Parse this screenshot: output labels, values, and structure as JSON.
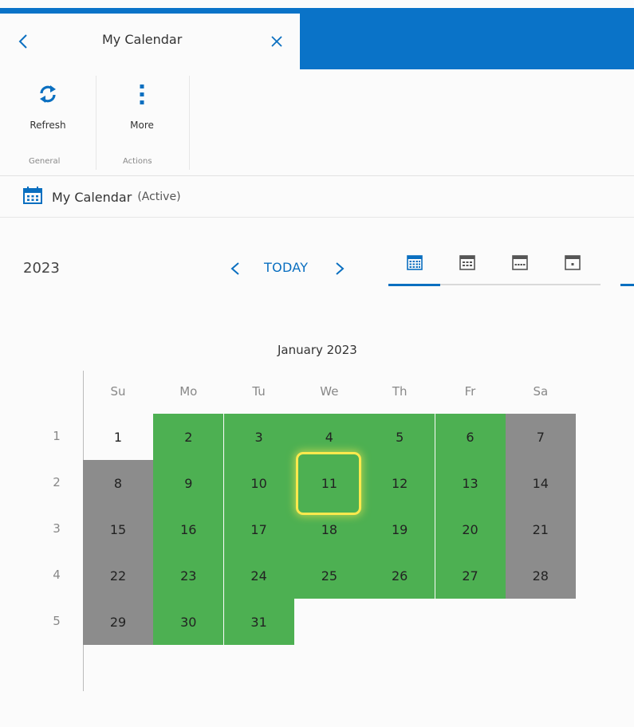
{
  "tab": {
    "title": "My Calendar",
    "back_icon": "chevron-left-icon",
    "close_icon": "close-icon"
  },
  "ribbon": {
    "refresh_label": "Refresh",
    "more_label": "More",
    "group_general": "General",
    "group_actions": "Actions"
  },
  "breadcrumb": {
    "icon": "calendar-icon",
    "name": "My Calendar",
    "state": "(Active)"
  },
  "nav": {
    "year": "2023",
    "today_label": "TODAY",
    "views": [
      "year-view-icon",
      "month-view-icon",
      "week-view-icon",
      "day-view-icon"
    ],
    "active_view": 0
  },
  "calendar": {
    "month_title": "January 2023",
    "weekdays": [
      "Su",
      "Mo",
      "Tu",
      "We",
      "Th",
      "Fr",
      "Sa"
    ],
    "week_numbers": [
      "1",
      "2",
      "3",
      "4",
      "5"
    ],
    "today": "11",
    "weeks": [
      [
        {
          "d": "1",
          "t": "plain"
        },
        {
          "d": "2",
          "t": "work"
        },
        {
          "d": "3",
          "t": "work"
        },
        {
          "d": "4",
          "t": "work"
        },
        {
          "d": "5",
          "t": "work"
        },
        {
          "d": "6",
          "t": "work"
        },
        {
          "d": "7",
          "t": "weekend"
        }
      ],
      [
        {
          "d": "8",
          "t": "weekend"
        },
        {
          "d": "9",
          "t": "work"
        },
        {
          "d": "10",
          "t": "work"
        },
        {
          "d": "11",
          "t": "work"
        },
        {
          "d": "12",
          "t": "work"
        },
        {
          "d": "13",
          "t": "work"
        },
        {
          "d": "14",
          "t": "weekend"
        }
      ],
      [
        {
          "d": "15",
          "t": "weekend"
        },
        {
          "d": "16",
          "t": "work"
        },
        {
          "d": "17",
          "t": "work"
        },
        {
          "d": "18",
          "t": "work"
        },
        {
          "d": "19",
          "t": "work"
        },
        {
          "d": "20",
          "t": "work"
        },
        {
          "d": "21",
          "t": "weekend"
        }
      ],
      [
        {
          "d": "22",
          "t": "weekend"
        },
        {
          "d": "23",
          "t": "work"
        },
        {
          "d": "24",
          "t": "work"
        },
        {
          "d": "25",
          "t": "work"
        },
        {
          "d": "26",
          "t": "work"
        },
        {
          "d": "27",
          "t": "work"
        },
        {
          "d": "28",
          "t": "weekend"
        }
      ],
      [
        {
          "d": "29",
          "t": "weekend"
        },
        {
          "d": "30",
          "t": "work"
        },
        {
          "d": "31",
          "t": "work"
        }
      ]
    ]
  },
  "colors": {
    "accent": "#0a73c8",
    "workday": "#4db052",
    "weekend": "#8c8c8c",
    "today_ring": "#ffe94d"
  }
}
